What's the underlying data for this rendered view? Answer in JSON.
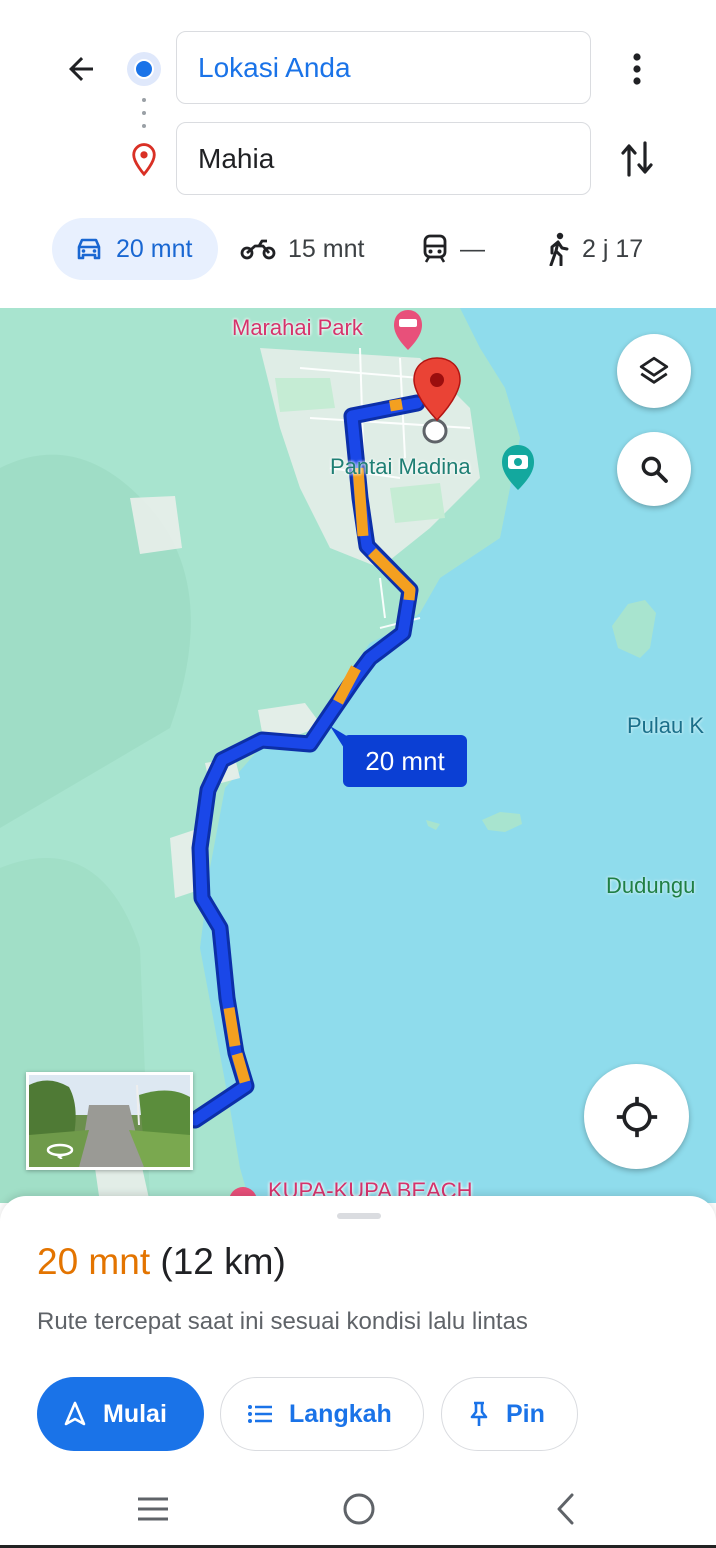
{
  "header": {
    "origin_value": "Lokasi Anda",
    "destination_value": "Mahia",
    "icons": {
      "back": "arrow-back-icon",
      "more": "more-vert-icon",
      "swap": "swap-vert-icon",
      "origin": "my-location-dot-icon",
      "destination": "place-pin-icon"
    }
  },
  "modes": [
    {
      "id": "car",
      "label": "20 mnt",
      "icon": "car-icon",
      "selected": true
    },
    {
      "id": "motorcycle",
      "label": "15 mnt",
      "icon": "motorcycle-icon",
      "selected": false
    },
    {
      "id": "transit",
      "label": "—",
      "icon": "train-icon",
      "selected": false
    },
    {
      "id": "walk",
      "label": "2 j 17",
      "icon": "walk-icon",
      "selected": false
    }
  ],
  "map": {
    "labels": {
      "park": "Marahai Park",
      "beach_madina": "Pantai Madina",
      "pulau": "Pulau K",
      "dudungu": "Dudungu",
      "kupa": "KUPA-KUPA BEACH"
    },
    "eta_bubble": "20 mnt",
    "colors": {
      "route_fast": "#1a47e8",
      "route_slow": "#f4a020",
      "water": "#8fdcec",
      "land": "#a6e3d0",
      "destination_pin": "#ea4335"
    }
  },
  "sheet": {
    "duration": "20 mnt",
    "distance": "(12 km)",
    "description": "Rute tercepat saat ini sesuai kondisi lalu lintas",
    "start_label": "Mulai",
    "steps_label": "Langkah",
    "pin_label": "Pin"
  }
}
